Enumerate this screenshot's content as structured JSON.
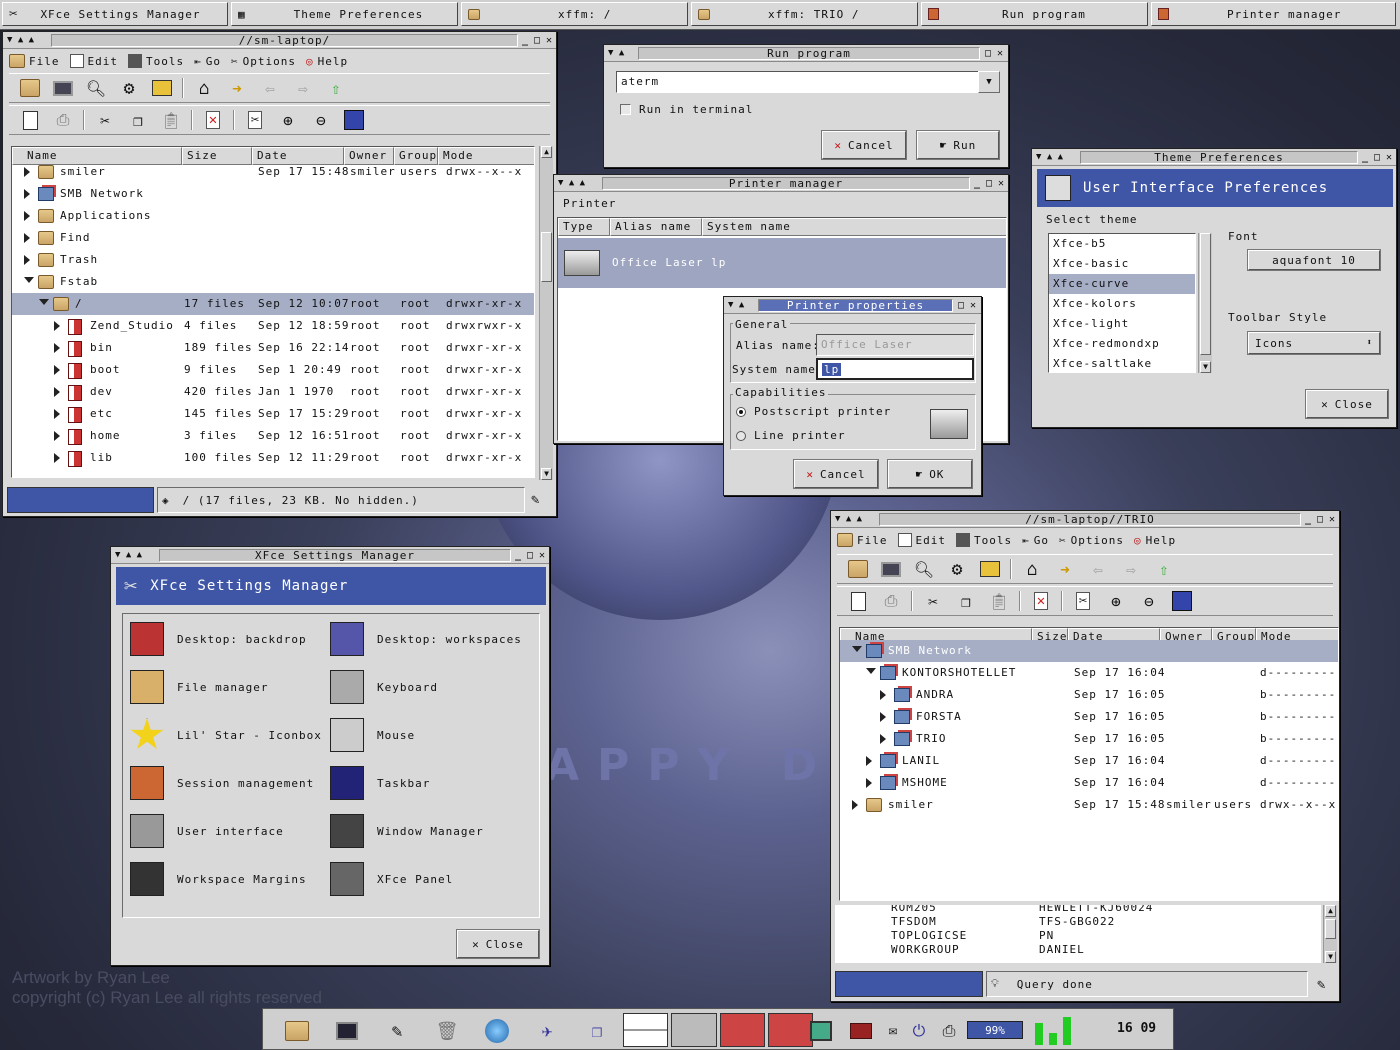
{
  "taskbar": [
    {
      "label": "XFce Settings Manager"
    },
    {
      "label": "Theme Preferences"
    },
    {
      "label": "xffm: /"
    },
    {
      "label": "xffm: TRIO /"
    },
    {
      "label": "Run program"
    },
    {
      "label": "Printer manager"
    }
  ],
  "fm1": {
    "title": "//sm-laptop/",
    "menu": [
      "File",
      "Edit",
      "Tools",
      "Go",
      "Options",
      "Help"
    ],
    "columns": [
      "Name",
      "Size",
      "Date",
      "Owner",
      "Group",
      "Mode"
    ],
    "rows": [
      {
        "name": "smiler",
        "size": "",
        "date": "Sep 17 15:48",
        "owner": "smiler",
        "group": "users",
        "mode": "drwx--x--x"
      },
      {
        "name": "SMB Network",
        "size": "",
        "date": "",
        "owner": "",
        "group": "",
        "mode": ""
      },
      {
        "name": "Applications",
        "size": "",
        "date": "",
        "owner": "",
        "group": "",
        "mode": ""
      },
      {
        "name": "Find",
        "size": "",
        "date": "",
        "owner": "",
        "group": "",
        "mode": ""
      },
      {
        "name": "Trash",
        "size": "",
        "date": "",
        "owner": "",
        "group": "",
        "mode": ""
      },
      {
        "name": "Fstab",
        "size": "",
        "date": "",
        "owner": "",
        "group": "",
        "mode": ""
      },
      {
        "name": "/",
        "size": "17 files",
        "date": "Sep 12 10:07",
        "owner": "root",
        "group": "root",
        "mode": "drwxr-xr-x"
      },
      {
        "name": "Zend_Studio",
        "size": "4 files",
        "date": "Sep 12 18:59",
        "owner": "root",
        "group": "root",
        "mode": "drwxrwxr-x"
      },
      {
        "name": "bin",
        "size": "189 files",
        "date": "Sep 16 22:14",
        "owner": "root",
        "group": "root",
        "mode": "drwxr-xr-x"
      },
      {
        "name": "boot",
        "size": "9 files",
        "date": "Sep  1 20:49",
        "owner": "root",
        "group": "root",
        "mode": "drwxr-xr-x"
      },
      {
        "name": "dev",
        "size": "420 files",
        "date": "Jan  1  1970",
        "owner": "root",
        "group": "root",
        "mode": "drwxr-xr-x"
      },
      {
        "name": "etc",
        "size": "145 files",
        "date": "Sep 17 15:29",
        "owner": "root",
        "group": "root",
        "mode": "drwxr-xr-x"
      },
      {
        "name": "home",
        "size": "3 files",
        "date": "Sep 12 16:51",
        "owner": "root",
        "group": "root",
        "mode": "drwxr-xr-x"
      },
      {
        "name": "lib",
        "size": "100 files",
        "date": "Sep 12 11:29",
        "owner": "root",
        "group": "root",
        "mode": "drwxr-xr-x"
      }
    ],
    "status": "/ (17 files, 23 KB. No hidden.)"
  },
  "run": {
    "title": "Run program",
    "command": "aterm",
    "checkbox_label": "Run in terminal",
    "cancel": "Cancel",
    "run": "Run"
  },
  "printer": {
    "title": "Printer manager",
    "menu": "Printer",
    "columns": [
      "Type",
      "Alias name",
      "System name"
    ],
    "item": "Office Laser  lp"
  },
  "props": {
    "title": "Printer properties",
    "general": "General",
    "alias_label": "Alias name:",
    "alias_value": "Office Laser",
    "system_label": "System name:",
    "system_value": "lp",
    "capabilities": "Capabilities",
    "opt1": "Postscript printer",
    "opt2": "Line printer",
    "cancel": "Cancel",
    "ok": "OK"
  },
  "theme": {
    "title": "Theme Preferences",
    "banner": "User Interface Preferences",
    "select_label": "Select theme",
    "themes": [
      "Xfce-b5",
      "Xfce-basic",
      "Xfce-curve",
      "Xfce-kolors",
      "Xfce-light",
      "Xfce-redmondxp",
      "Xfce-saltlake"
    ],
    "font_label": "Font",
    "font_value": "aquafont 10",
    "toolbar_label": "Toolbar Style",
    "toolbar_value": "Icons",
    "close": "Close"
  },
  "settings": {
    "title": "XFce Settings Manager",
    "banner": "XFce Settings Manager",
    "items": [
      "Desktop: backdrop",
      "Desktop: workspaces",
      "File manager",
      "Keyboard",
      "Lil' Star - Iconbox",
      "Mouse",
      "Session management",
      "Taskbar",
      "User interface",
      "Window Manager",
      "Workspace Margins",
      "XFce Panel"
    ],
    "close": "Close"
  },
  "fm2": {
    "title": "//sm-laptop//TRIO",
    "menu": [
      "File",
      "Edit",
      "Tools",
      "Go",
      "Options",
      "Help"
    ],
    "columns": [
      "Name",
      "Size",
      "Date",
      "Owner",
      "Group",
      "Mode"
    ],
    "rows": [
      {
        "name": "SMB Network",
        "date": "",
        "owner": "",
        "group": "",
        "mode": ""
      },
      {
        "name": "KONTORSHOTELLET",
        "date": "Sep 17 16:04",
        "owner": "",
        "group": "",
        "mode": "d---------"
      },
      {
        "name": "ANDRA",
        "date": "Sep 17 16:05",
        "owner": "",
        "group": "",
        "mode": "b---------"
      },
      {
        "name": "FORSTA",
        "date": "Sep 17 16:05",
        "owner": "",
        "group": "",
        "mode": "b---------"
      },
      {
        "name": "TRIO",
        "date": "Sep 17 16:05",
        "owner": "",
        "group": "",
        "mode": "b---------"
      },
      {
        "name": "LANIL",
        "date": "Sep 17 16:04",
        "owner": "",
        "group": "",
        "mode": "d---------"
      },
      {
        "name": "MSHOME",
        "date": "Sep 17 16:04",
        "owner": "",
        "group": "",
        "mode": "d---------"
      },
      {
        "name": "smiler",
        "date": "Sep 17 15:48",
        "owner": "smiler",
        "group": "users",
        "mode": "drwx--x--x"
      }
    ],
    "log": [
      [
        "ROM205",
        "HEWLETT-KJ60024"
      ],
      [
        "TFSDOM",
        "TFS-GBG022"
      ],
      [
        "TOPLOGICSE",
        "PN"
      ],
      [
        "WORKGROUP",
        "DANIEL"
      ]
    ],
    "status": "Query done"
  },
  "wallpaper": {
    "credit1": "Artwork by Ryan Lee",
    "credit2": "copyright (c) Ryan Lee all rights reserved",
    "logo": "APPY DAN"
  },
  "panel": {
    "battery": "99%",
    "clock": "16 09"
  }
}
